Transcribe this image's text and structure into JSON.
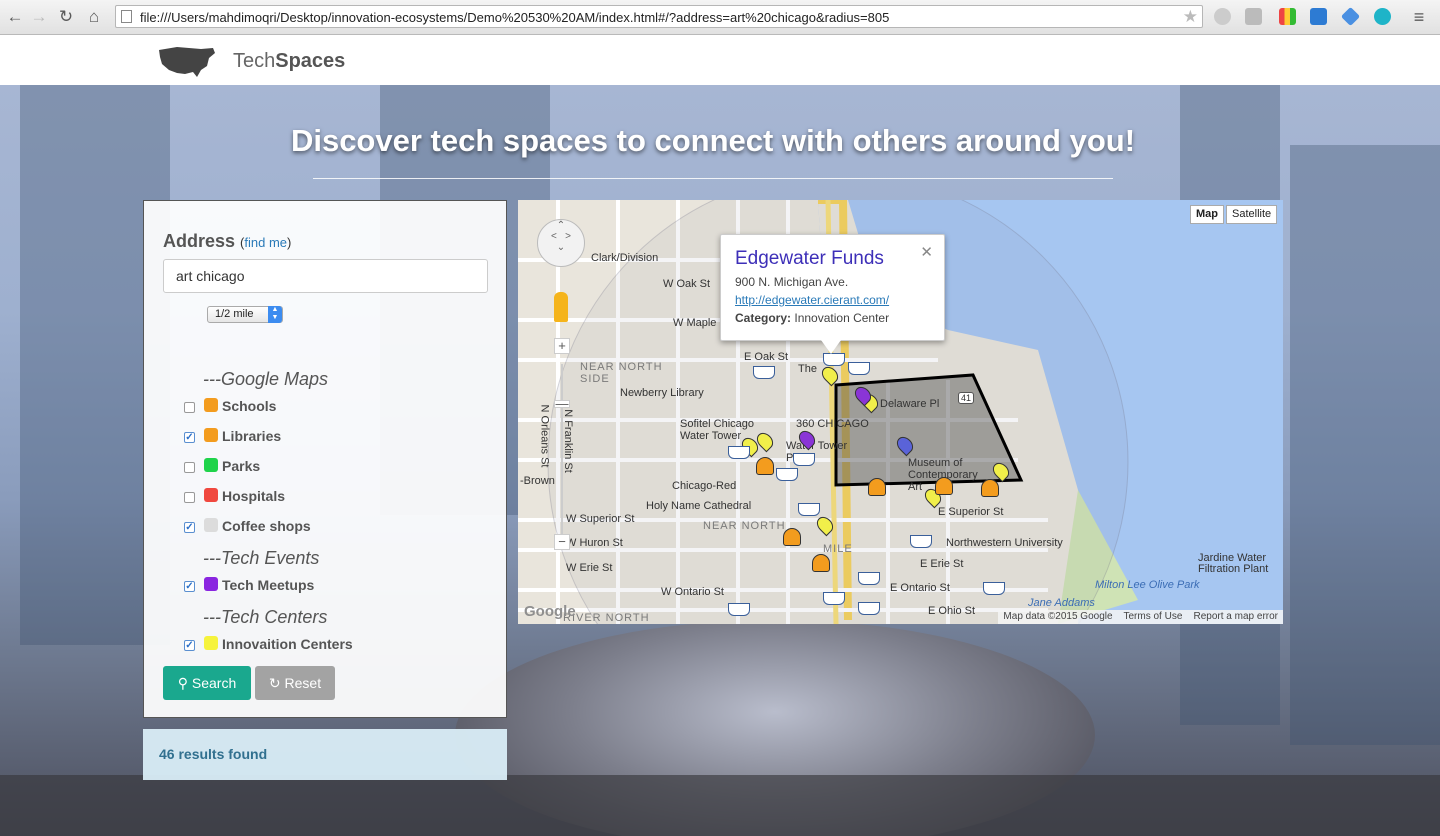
{
  "browser": {
    "url": "file:///Users/mahdimoqri/Desktop/innovation-ecosystems/Demo%20530%20AM/index.html#/?address=art%20chicago&radius=805"
  },
  "site": {
    "brand_light": "Tech",
    "brand_bold": "Spaces",
    "tagline": "Discover tech spaces to connect with others around you!"
  },
  "search": {
    "address_label": "Address",
    "find_me_open": "(",
    "find_me": "find me",
    "find_me_close": ")",
    "address_value": "art chicago",
    "radius_selected": "1/2 mile",
    "groups": [
      {
        "title": "---Google Maps",
        "items": [
          {
            "label": "Schools",
            "checked": false,
            "color": "#f39c1e"
          },
          {
            "label": "Libraries",
            "checked": true,
            "color": "#f39c1e"
          },
          {
            "label": "Parks",
            "checked": false,
            "color": "#1fd34a"
          },
          {
            "label": "Hospitals",
            "checked": false,
            "color": "#f0483e"
          },
          {
            "label": "Coffee shops",
            "checked": true,
            "color": "#dcdcdc"
          }
        ]
      },
      {
        "title": "---Tech Events",
        "items": [
          {
            "label": "Tech Meetups",
            "checked": true,
            "color": "#8a25e0"
          }
        ]
      },
      {
        "title": "---Tech Centers",
        "items": [
          {
            "label": "Innovaition Centers",
            "checked": true,
            "color": "#f6f33c"
          }
        ]
      }
    ],
    "search_button": "Search",
    "reset_button": "Reset",
    "results_text": "46 results found"
  },
  "map": {
    "type_buttons": [
      "Map",
      "Satellite"
    ],
    "labels": [
      "Clark/Division",
      "E Oak St",
      "W Oak St",
      "W Maple St",
      "NEAR NORTH SIDE",
      "Newberry Library",
      "Sofitel Chicago Water Tower",
      "360 CHICAGO",
      "Water Tower Place",
      "Delaware Pl",
      "Museum of Contemporary Art",
      "Chicago-Red",
      "-Brown",
      "Holy Name Cathedral",
      "NEAR NORTH",
      "MILE",
      "W Superior St",
      "E Superior St",
      "Northwestern University",
      "W Huron St",
      "W Erie St",
      "E Erie St",
      "W Ontario St",
      "E Ontario St",
      "E Ohio St",
      "RIVER NORTH",
      "Jardine Water Filtration Plant",
      "Milton Lee Olive Park",
      "Jane Addams",
      "N Orleans St",
      "N Franklin St",
      "The",
      "41"
    ],
    "infowindow": {
      "title": "Edgewater Funds",
      "address": "900 N. Michigan Ave.",
      "url": "http://edgewater.cierant.com/",
      "category_label": "Category:",
      "category_value": "Innovation Center"
    },
    "attribution": [
      "Map data ©2015 Google",
      "Terms of Use",
      "Report a map error"
    ],
    "google_mark": "Google"
  }
}
